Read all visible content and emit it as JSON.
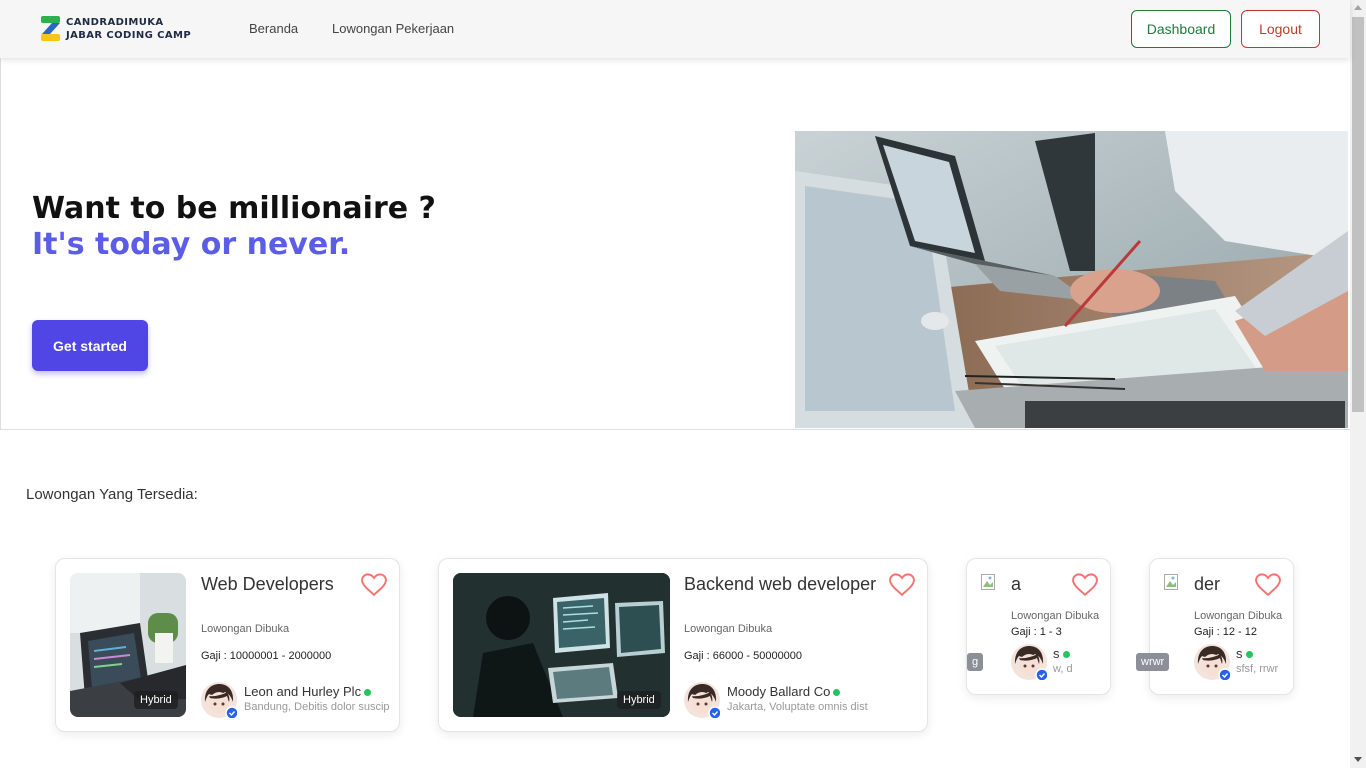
{
  "navbar": {
    "logo_line1": "CANDRADIMUKA",
    "logo_line2": "JABAR CODING CAMP",
    "links": [
      "Beranda",
      "Lowongan Pekerjaan"
    ],
    "dashboard_label": "Dashboard",
    "logout_label": "Logout"
  },
  "hero": {
    "headline": "Want to be millionaire ?",
    "subheadline": "It's today or never.",
    "cta_label": "Get started"
  },
  "section_title": "Lowongan Yang Tersedia:",
  "jobs": [
    {
      "title": "Web Developers",
      "status": "Lowongan Dibuka",
      "salary": "Gaji : 10000001 - 2000000",
      "company": "Leon and Hurley Plc",
      "location": "Bandung, Debitis dolor suscip",
      "work_type": "Hybrid"
    },
    {
      "title": "Backend web developer",
      "status": "Lowongan Dibuka",
      "salary": "Gaji : 66000 - 50000000",
      "company": "Moody Ballard Co",
      "location": "Jakarta, Voluptate omnis dist",
      "work_type": "Hybrid"
    },
    {
      "title": "a",
      "status": "Lowongan Dibuka",
      "salary": "Gaji : 1 - 3",
      "company": "s",
      "location": "w, d",
      "work_type": "g"
    },
    {
      "title": "der",
      "status": "Lowongan Dibuka",
      "salary": "Gaji : 12 - 12",
      "company": "s",
      "location": "sfsf, rrwr",
      "work_type": "wrwr"
    }
  ],
  "colors": {
    "brand": "#4f46e5",
    "accent_text": "#5b5de6",
    "dashboard": "#1c7c3a",
    "logout": "#c0392b",
    "online": "#22c55e",
    "heart": "#f87171"
  }
}
